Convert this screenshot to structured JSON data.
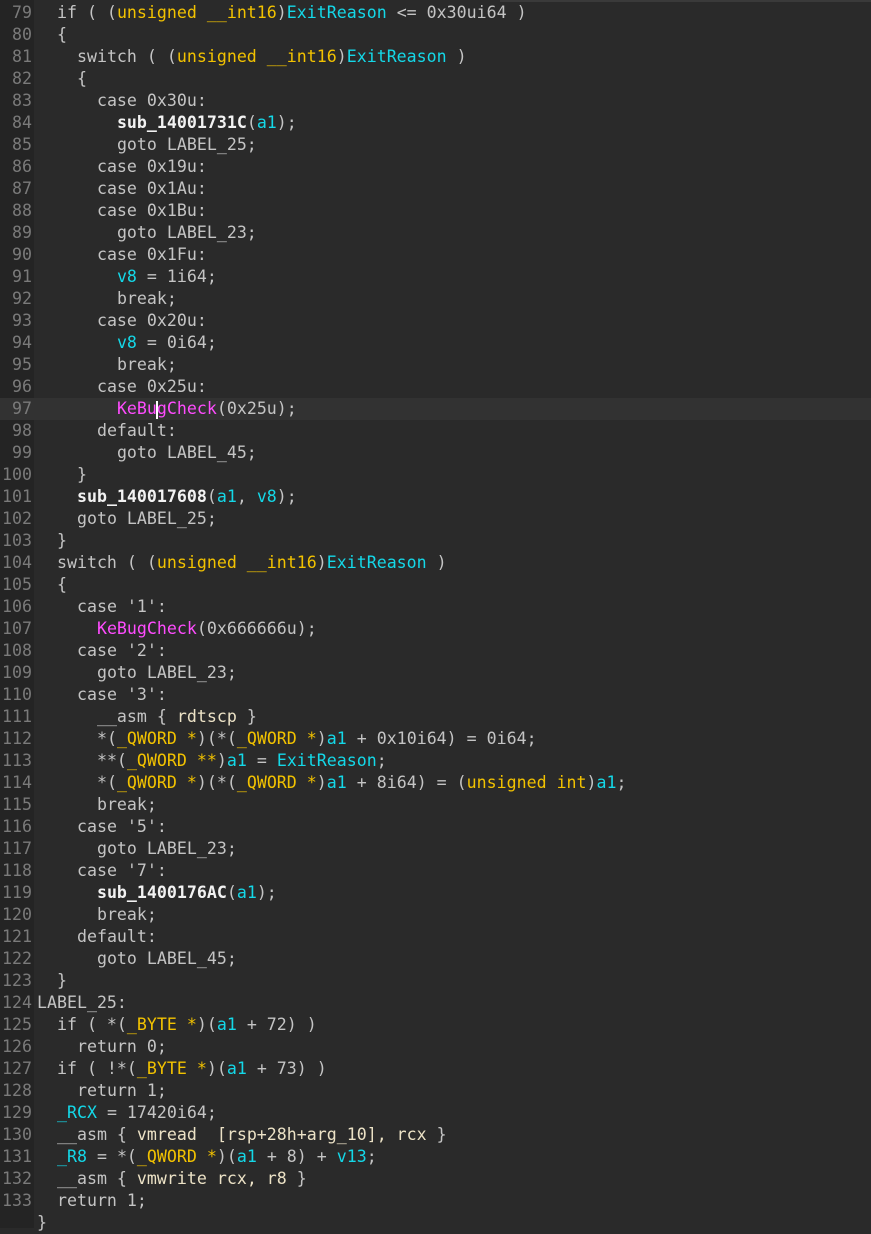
{
  "view": "pseudocode",
  "cursor": {
    "line": 97,
    "after_text": "KeBu"
  },
  "lines": [
    {
      "n": "79",
      "indent": 1,
      "tokens": [
        [
          "p",
          "if ( ("
        ],
        [
          "t",
          "unsigned __int16"
        ],
        [
          "p",
          ")"
        ],
        [
          "v",
          "ExitReason"
        ],
        [
          "p",
          " <= 0x30ui64 )"
        ]
      ]
    },
    {
      "n": "80",
      "indent": 1,
      "tokens": [
        [
          "p",
          "{"
        ]
      ]
    },
    {
      "n": "81",
      "indent": 2,
      "tokens": [
        [
          "p",
          "switch ( ("
        ],
        [
          "t",
          "unsigned __int16"
        ],
        [
          "p",
          ")"
        ],
        [
          "v",
          "ExitReason"
        ],
        [
          "p",
          " )"
        ]
      ]
    },
    {
      "n": "82",
      "indent": 2,
      "tokens": [
        [
          "p",
          "{"
        ]
      ]
    },
    {
      "n": "83",
      "indent": 3,
      "tokens": [
        [
          "p",
          "case 0x30u:"
        ]
      ]
    },
    {
      "n": "84",
      "indent": 4,
      "tokens": [
        [
          "f",
          "sub_14001731C"
        ],
        [
          "p",
          "("
        ],
        [
          "v",
          "a1"
        ],
        [
          "p",
          ");"
        ]
      ]
    },
    {
      "n": "85",
      "indent": 4,
      "tokens": [
        [
          "p",
          "goto LABEL_25;"
        ]
      ]
    },
    {
      "n": "86",
      "indent": 3,
      "tokens": [
        [
          "p",
          "case 0x19u:"
        ]
      ]
    },
    {
      "n": "87",
      "indent": 3,
      "tokens": [
        [
          "p",
          "case 0x1Au:"
        ]
      ]
    },
    {
      "n": "88",
      "indent": 3,
      "tokens": [
        [
          "p",
          "case 0x1Bu:"
        ]
      ]
    },
    {
      "n": "89",
      "indent": 4,
      "tokens": [
        [
          "p",
          "goto LABEL_23;"
        ]
      ]
    },
    {
      "n": "90",
      "indent": 3,
      "tokens": [
        [
          "p",
          "case 0x1Fu:"
        ]
      ]
    },
    {
      "n": "91",
      "indent": 4,
      "tokens": [
        [
          "v",
          "v8"
        ],
        [
          "p",
          " = 1i64;"
        ]
      ]
    },
    {
      "n": "92",
      "indent": 4,
      "tokens": [
        [
          "p",
          "break;"
        ]
      ]
    },
    {
      "n": "93",
      "indent": 3,
      "tokens": [
        [
          "p",
          "case 0x20u:"
        ]
      ]
    },
    {
      "n": "94",
      "indent": 4,
      "tokens": [
        [
          "v",
          "v8"
        ],
        [
          "p",
          " = 0i64;"
        ]
      ]
    },
    {
      "n": "95",
      "indent": 4,
      "tokens": [
        [
          "p",
          "break;"
        ]
      ]
    },
    {
      "n": "96",
      "indent": 3,
      "tokens": [
        [
          "p",
          "case 0x25u:"
        ]
      ]
    },
    {
      "n": "97",
      "indent": 4,
      "tokens": [
        [
          "m",
          "KeBu"
        ],
        [
          "caret",
          ""
        ],
        [
          "m",
          "gCheck"
        ],
        [
          "p",
          "(0x25u);"
        ]
      ]
    },
    {
      "n": "98",
      "indent": 3,
      "tokens": [
        [
          "p",
          "default:"
        ]
      ]
    },
    {
      "n": "99",
      "indent": 4,
      "tokens": [
        [
          "p",
          "goto LABEL_45;"
        ]
      ]
    },
    {
      "n": "100",
      "indent": 2,
      "tokens": [
        [
          "p",
          "}"
        ]
      ]
    },
    {
      "n": "101",
      "indent": 2,
      "tokens": [
        [
          "f",
          "sub_140017608"
        ],
        [
          "p",
          "("
        ],
        [
          "v",
          "a1"
        ],
        [
          "p",
          ", "
        ],
        [
          "v",
          "v8"
        ],
        [
          "p",
          ");"
        ]
      ]
    },
    {
      "n": "102",
      "indent": 2,
      "tokens": [
        [
          "p",
          "goto LABEL_25;"
        ]
      ]
    },
    {
      "n": "103",
      "indent": 1,
      "tokens": [
        [
          "p",
          "}"
        ]
      ]
    },
    {
      "n": "104",
      "indent": 1,
      "tokens": [
        [
          "p",
          "switch ( ("
        ],
        [
          "t",
          "unsigned __int16"
        ],
        [
          "p",
          ")"
        ],
        [
          "v",
          "ExitReason"
        ],
        [
          "p",
          " )"
        ]
      ]
    },
    {
      "n": "105",
      "indent": 1,
      "tokens": [
        [
          "p",
          "{"
        ]
      ]
    },
    {
      "n": "106",
      "indent": 2,
      "tokens": [
        [
          "p",
          "case '1':"
        ]
      ]
    },
    {
      "n": "107",
      "indent": 3,
      "tokens": [
        [
          "m",
          "KeBugCheck"
        ],
        [
          "p",
          "(0x666666u);"
        ]
      ]
    },
    {
      "n": "108",
      "indent": 2,
      "tokens": [
        [
          "p",
          "case '2':"
        ]
      ]
    },
    {
      "n": "109",
      "indent": 3,
      "tokens": [
        [
          "p",
          "goto LABEL_23;"
        ]
      ]
    },
    {
      "n": "110",
      "indent": 2,
      "tokens": [
        [
          "p",
          "case '3':"
        ]
      ]
    },
    {
      "n": "111",
      "indent": 3,
      "tokens": [
        [
          "p",
          "__asm { "
        ],
        [
          "a",
          "rdtscp"
        ],
        [
          "p",
          " }"
        ]
      ]
    },
    {
      "n": "112",
      "indent": 3,
      "tokens": [
        [
          "p",
          "*("
        ],
        [
          "t",
          "_QWORD *"
        ],
        [
          "p",
          ")(*("
        ],
        [
          "t",
          "_QWORD *"
        ],
        [
          "p",
          ")"
        ],
        [
          "v",
          "a1"
        ],
        [
          "p",
          " + 0x10i64) = 0i64;"
        ]
      ]
    },
    {
      "n": "113",
      "indent": 3,
      "tokens": [
        [
          "p",
          "**("
        ],
        [
          "t",
          "_QWORD **"
        ],
        [
          "p",
          ")"
        ],
        [
          "v",
          "a1"
        ],
        [
          "p",
          " = "
        ],
        [
          "v",
          "ExitReason"
        ],
        [
          "p",
          ";"
        ]
      ]
    },
    {
      "n": "114",
      "indent": 3,
      "tokens": [
        [
          "p",
          "*("
        ],
        [
          "t",
          "_QWORD *"
        ],
        [
          "p",
          ")(*("
        ],
        [
          "t",
          "_QWORD *"
        ],
        [
          "p",
          ")"
        ],
        [
          "v",
          "a1"
        ],
        [
          "p",
          " + 8i64) = ("
        ],
        [
          "t",
          "unsigned int"
        ],
        [
          "p",
          ")"
        ],
        [
          "v",
          "a1"
        ],
        [
          "p",
          ";"
        ]
      ]
    },
    {
      "n": "115",
      "indent": 3,
      "tokens": [
        [
          "p",
          "break;"
        ]
      ]
    },
    {
      "n": "116",
      "indent": 2,
      "tokens": [
        [
          "p",
          "case '5':"
        ]
      ]
    },
    {
      "n": "117",
      "indent": 3,
      "tokens": [
        [
          "p",
          "goto LABEL_23;"
        ]
      ]
    },
    {
      "n": "118",
      "indent": 2,
      "tokens": [
        [
          "p",
          "case '7':"
        ]
      ]
    },
    {
      "n": "119",
      "indent": 3,
      "tokens": [
        [
          "f",
          "sub_1400176AC"
        ],
        [
          "p",
          "("
        ],
        [
          "v",
          "a1"
        ],
        [
          "p",
          ");"
        ]
      ]
    },
    {
      "n": "120",
      "indent": 3,
      "tokens": [
        [
          "p",
          "break;"
        ]
      ]
    },
    {
      "n": "121",
      "indent": 2,
      "tokens": [
        [
          "p",
          "default:"
        ]
      ]
    },
    {
      "n": "122",
      "indent": 3,
      "tokens": [
        [
          "p",
          "goto LABEL_45;"
        ]
      ]
    },
    {
      "n": "123",
      "indent": 1,
      "tokens": [
        [
          "p",
          "}"
        ]
      ]
    },
    {
      "n": "124",
      "indent": 0,
      "tokens": [
        [
          "p",
          "LABEL_25:"
        ]
      ]
    },
    {
      "n": "125",
      "indent": 1,
      "tokens": [
        [
          "p",
          "if ( *("
        ],
        [
          "t",
          "_BYTE *"
        ],
        [
          "p",
          ")("
        ],
        [
          "v",
          "a1"
        ],
        [
          "p",
          " + 72) )"
        ]
      ]
    },
    {
      "n": "126",
      "indent": 2,
      "tokens": [
        [
          "p",
          "return 0;"
        ]
      ]
    },
    {
      "n": "127",
      "indent": 1,
      "tokens": [
        [
          "p",
          "if ( !*("
        ],
        [
          "t",
          "_BYTE *"
        ],
        [
          "p",
          ")("
        ],
        [
          "v",
          "a1"
        ],
        [
          "p",
          " + 73) )"
        ]
      ]
    },
    {
      "n": "128",
      "indent": 2,
      "tokens": [
        [
          "p",
          "return 1;"
        ]
      ]
    },
    {
      "n": "129",
      "indent": 1,
      "tokens": [
        [
          "v",
          "_RCX"
        ],
        [
          "p",
          " = 17420i64;"
        ]
      ]
    },
    {
      "n": "130",
      "indent": 1,
      "tokens": [
        [
          "p",
          "__asm { "
        ],
        [
          "a",
          "vmread  [rsp+28h+arg_10], rcx"
        ],
        [
          "p",
          " }"
        ]
      ]
    },
    {
      "n": "131",
      "indent": 1,
      "tokens": [
        [
          "v",
          "_R8"
        ],
        [
          "p",
          " = *("
        ],
        [
          "t",
          "_QWORD *"
        ],
        [
          "p",
          ")("
        ],
        [
          "v",
          "a1"
        ],
        [
          "p",
          " + 8) + "
        ],
        [
          "v",
          "v13"
        ],
        [
          "p",
          ";"
        ]
      ]
    },
    {
      "n": "132",
      "indent": 1,
      "tokens": [
        [
          "p",
          "__asm { "
        ],
        [
          "a",
          "vmwrite rcx, r8"
        ],
        [
          "p",
          " }"
        ]
      ]
    },
    {
      "n": "133",
      "indent": 1,
      "tokens": [
        [
          "p",
          "return 1;"
        ]
      ]
    },
    {
      "n": "",
      "indent": 0,
      "tokens": [
        [
          "p",
          "}"
        ]
      ]
    }
  ]
}
